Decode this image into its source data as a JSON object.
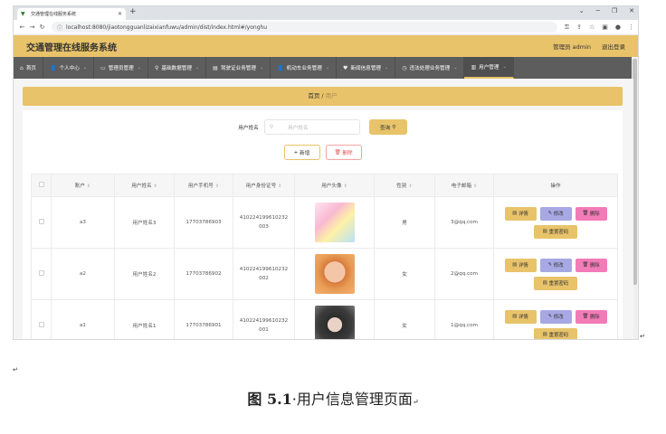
{
  "browser": {
    "tab_title": "交通管理在线服务系统",
    "url": "localhost:8080/jiaotongguanlizaixianfuwu/admin/dist/index.html#/yonghu"
  },
  "app": {
    "title": "交通管理在线服务系统",
    "admin_label": "管理员 admin",
    "logout": "退出登录"
  },
  "menu": [
    {
      "label": "首页",
      "icon": "home-icon"
    },
    {
      "label": "个人中心",
      "icon": "user-icon"
    },
    {
      "label": "管理员管理",
      "icon": "admin-icon"
    },
    {
      "label": "基础数据管理",
      "icon": "location-icon"
    },
    {
      "label": "驾驶证业务管理",
      "icon": "card-icon"
    },
    {
      "label": "机动车业务管理",
      "icon": "car-icon"
    },
    {
      "label": "新闻信息管理",
      "icon": "news-icon"
    },
    {
      "label": "违法处理业务管理",
      "icon": "clock-icon"
    },
    {
      "label": "用户管理",
      "icon": "chart-icon"
    }
  ],
  "breadcrumb": {
    "home": "首页",
    "sep": "/",
    "current": "用户"
  },
  "search": {
    "label": "用户姓名",
    "placeholder": "用户姓名",
    "button": "查询"
  },
  "actions": {
    "add": "新增",
    "delete": "删除"
  },
  "table": {
    "headers": [
      "账户",
      "用户姓名",
      "用户手机号",
      "用户身份证号",
      "用户头像",
      "性别",
      "电子邮箱",
      "操作"
    ],
    "rows": [
      {
        "account": "a3",
        "name": "用户姓名3",
        "phone": "17703786903",
        "id1": "410224199610232",
        "id2": "003",
        "gender": "男",
        "email": "3@qq.com"
      },
      {
        "account": "a2",
        "name": "用户姓名2",
        "phone": "17703786902",
        "id1": "410224199610232",
        "id2": "002",
        "gender": "女",
        "email": "2@qq.com"
      },
      {
        "account": "a1",
        "name": "用户姓名1",
        "phone": "17703786901",
        "id1": "410224199610232",
        "id2": "001",
        "gender": "女",
        "email": "1@qq.com"
      }
    ],
    "ops": {
      "detail": "详情",
      "edit": "修改",
      "remove": "删除",
      "reset": "重置密码"
    }
  },
  "caption": {
    "fig": "图 5.1",
    "dot": "·",
    "text": "用户信息管理页面"
  }
}
